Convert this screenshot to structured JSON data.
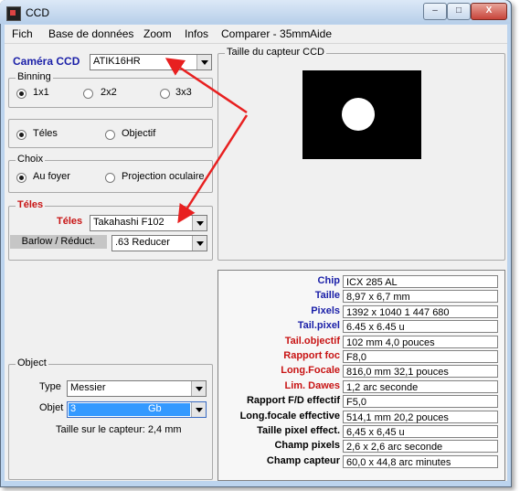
{
  "window": {
    "title": "CCD",
    "buttons": {
      "minimize": "–",
      "maximize": "□",
      "close": "X"
    }
  },
  "menu": [
    "Fich",
    "Base de données",
    "Zoom",
    "Infos",
    "Comparer - 35mm",
    "Aide"
  ],
  "camera": {
    "label": "Caméra CCD",
    "value": "ATIK16HR"
  },
  "binning": {
    "title": "Binning",
    "options": [
      "1x1",
      "2x2",
      "3x3"
    ],
    "selected": "1x1"
  },
  "mode": {
    "options": [
      "Téles",
      "Objectif"
    ],
    "selected": "Téles"
  },
  "choix": {
    "title": "Choix",
    "options": [
      "Au foyer",
      "Projection oculaire"
    ],
    "selected": "Au foyer"
  },
  "teles": {
    "title": "Téles",
    "label": "Téles",
    "value": "Takahashi F102",
    "barlow_label": "Barlow / Réduct.",
    "barlow_value": ".63 Reducer"
  },
  "sensor": {
    "title": "Taille du capteur CCD"
  },
  "object": {
    "title": "Object",
    "type_label": "Type",
    "type_value": "Messier",
    "objet_label": "Objet",
    "objet_value": "3",
    "objet_extra": "Gb",
    "size_text": "Taille sur le capteur:  2,4  mm"
  },
  "specs": [
    {
      "label": "Chip",
      "value": "ICX 285 AL",
      "color": "#1a1fa8"
    },
    {
      "label": "Taille",
      "value": "8,97 x 6,7 mm",
      "color": "#1a1fa8"
    },
    {
      "label": "Pixels",
      "value": "1392  x 1040     1 447 680",
      "color": "#1a1fa8"
    },
    {
      "label": "Tail.pixel",
      "value": "6.45  x 6.45  u",
      "color": "#1a1fa8"
    },
    {
      "label": "Tail.objectif",
      "value": "102 mm    4,0  pouces",
      "color": "#c81414"
    },
    {
      "label": "Rapport foc",
      "value": "F8,0",
      "color": "#c81414"
    },
    {
      "label": "Long.Focale",
      "value": "816,0 mm   32,1  pouces",
      "color": "#c81414"
    },
    {
      "label": "Lim. Dawes",
      "value": "1,2 arc seconde",
      "color": "#c81414"
    },
    {
      "label": "Rapport F/D effectif",
      "value": "F5,0",
      "color": "#000000"
    },
    {
      "label": "Long.focale effective",
      "value": "514,1 mm   20,2  pouces",
      "color": "#000000"
    },
    {
      "label": "Taille pixel effect.",
      "value": "6,45 x 6,45 u",
      "color": "#000000"
    },
    {
      "label": "Champ pixels",
      "value": "2,6 x 2,6  arc seconde",
      "color": "#000000"
    },
    {
      "label": "Champ capteur",
      "value": "60,0 x 44,8  arc minutes",
      "color": "#000000"
    }
  ]
}
